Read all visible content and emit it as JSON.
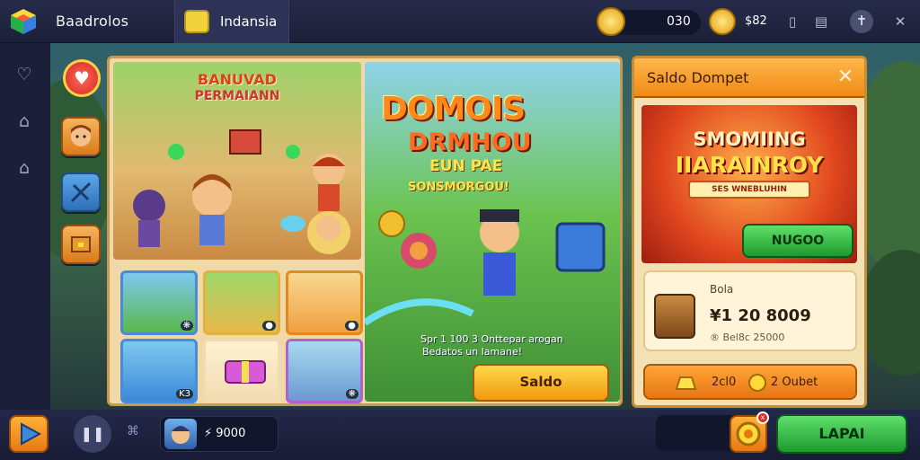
{
  "app": {
    "title": "Baadrolos"
  },
  "tab": {
    "label": "Indansia",
    "icon": "controller-icon"
  },
  "header": {
    "coin_value": "030",
    "gem_value": "$82",
    "icons": [
      "mobile-icon",
      "window-icon",
      "info-icon",
      "close-icon"
    ]
  },
  "left_nav": {
    "icons": [
      "heart-link-icon",
      "home-icon",
      "house-icon"
    ]
  },
  "side_icons": [
    "heart-icon",
    "hero-icon",
    "map-icon",
    "chest-icon"
  ],
  "left_banner": {
    "title": "BANUVAD",
    "subtitle": "PERMAIANN"
  },
  "main_banner": {
    "title_line1": "DOMOIS",
    "title_line2": "DRMHOU",
    "title_line3": "EUN PAE",
    "title_line4": "SONSMORGOU!",
    "desc_line1": "Spr 1 100 3 Onttepar arogan",
    "desc_line2": "Bedatos un lamane!",
    "play_button": "Saldo"
  },
  "thumbnails": [
    {
      "badge": "❋"
    },
    {
      "badge": "●"
    },
    {
      "badge": "●"
    },
    {
      "badge": "K3"
    },
    {
      "badge": ""
    },
    {
      "badge": "❋"
    }
  ],
  "side_panel": {
    "title": "Saldo Dompet",
    "promo_line1": "SMOMIING",
    "promo_line2": "IIARAINROY",
    "promo_line3": "SES WNEBLUHIN",
    "promo_button": "NUGOO",
    "card_label": "Bola",
    "card_amount": "¥1 20 8009",
    "card_sub": "® Bel8c 25000",
    "bar_value1": "2cl0",
    "bar_value2": "2 Oubet"
  },
  "bottom": {
    "profile_coins": "⚡ 9000",
    "go_button": "LAPAI",
    "notif_badge": "x"
  },
  "colors": {
    "accent_green": "#1e9a2e",
    "accent_orange": "#ef8a16",
    "bar_bg": "#1c2038"
  }
}
